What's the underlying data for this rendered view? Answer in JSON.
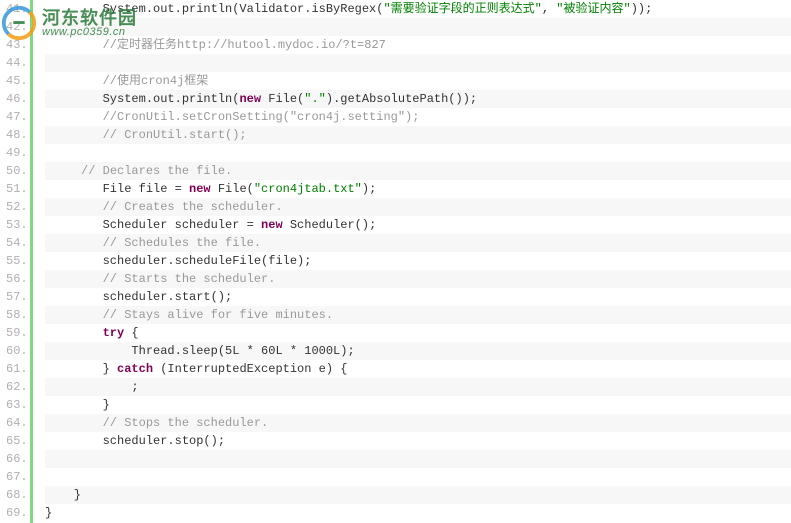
{
  "watermark": {
    "title": "河东软件园",
    "url": "www.pc0359.cn"
  },
  "startLine": 41,
  "lines": [
    {
      "alt": false,
      "tokens": [
        {
          "t": "        System.out.println(Validator.isByRegex(",
          "c": "default"
        },
        {
          "t": "\"需要验证字段的正则表达式\"",
          "c": "string"
        },
        {
          "t": ", ",
          "c": "default"
        },
        {
          "t": "\"被验证内容\"",
          "c": "string"
        },
        {
          "t": "));",
          "c": "default"
        }
      ]
    },
    {
      "alt": true,
      "tokens": [
        {
          "t": "",
          "c": "default"
        }
      ]
    },
    {
      "alt": false,
      "tokens": [
        {
          "t": "        ",
          "c": "default"
        },
        {
          "t": "//定时器任务http://hutool.mydoc.io/?t=827",
          "c": "comment"
        }
      ]
    },
    {
      "alt": true,
      "tokens": [
        {
          "t": "",
          "c": "default"
        }
      ]
    },
    {
      "alt": false,
      "tokens": [
        {
          "t": "        ",
          "c": "default"
        },
        {
          "t": "//使用cron4j框架",
          "c": "comment"
        }
      ]
    },
    {
      "alt": true,
      "tokens": [
        {
          "t": "        System.out.println(",
          "c": "default"
        },
        {
          "t": "new",
          "c": "keyword"
        },
        {
          "t": " File(",
          "c": "default"
        },
        {
          "t": "\".\"",
          "c": "string"
        },
        {
          "t": ").getAbsolutePath());",
          "c": "default"
        }
      ]
    },
    {
      "alt": false,
      "tokens": [
        {
          "t": "        ",
          "c": "default"
        },
        {
          "t": "//CronUtil.setCronSetting(\"cron4j.setting\");",
          "c": "comment"
        }
      ]
    },
    {
      "alt": true,
      "tokens": [
        {
          "t": "        ",
          "c": "default"
        },
        {
          "t": "// CronUtil.start();",
          "c": "comment"
        }
      ]
    },
    {
      "alt": false,
      "tokens": [
        {
          "t": "",
          "c": "default"
        }
      ]
    },
    {
      "alt": true,
      "tokens": [
        {
          "t": "     ",
          "c": "default"
        },
        {
          "t": "// Declares the file.",
          "c": "comment"
        }
      ]
    },
    {
      "alt": false,
      "tokens": [
        {
          "t": "        File file = ",
          "c": "default"
        },
        {
          "t": "new",
          "c": "keyword"
        },
        {
          "t": " File(",
          "c": "default"
        },
        {
          "t": "\"cron4jtab.txt\"",
          "c": "string"
        },
        {
          "t": ");",
          "c": "default"
        }
      ]
    },
    {
      "alt": true,
      "tokens": [
        {
          "t": "        ",
          "c": "default"
        },
        {
          "t": "// Creates the scheduler.",
          "c": "comment"
        }
      ]
    },
    {
      "alt": false,
      "tokens": [
        {
          "t": "        Scheduler scheduler = ",
          "c": "default"
        },
        {
          "t": "new",
          "c": "keyword"
        },
        {
          "t": " Scheduler();",
          "c": "default"
        }
      ]
    },
    {
      "alt": true,
      "tokens": [
        {
          "t": "        ",
          "c": "default"
        },
        {
          "t": "// Schedules the file.",
          "c": "comment"
        }
      ]
    },
    {
      "alt": false,
      "tokens": [
        {
          "t": "        scheduler.scheduleFile(file);",
          "c": "default"
        }
      ]
    },
    {
      "alt": true,
      "tokens": [
        {
          "t": "        ",
          "c": "default"
        },
        {
          "t": "// Starts the scheduler.",
          "c": "comment"
        }
      ]
    },
    {
      "alt": false,
      "tokens": [
        {
          "t": "        scheduler.start();",
          "c": "default"
        }
      ]
    },
    {
      "alt": true,
      "tokens": [
        {
          "t": "        ",
          "c": "default"
        },
        {
          "t": "// Stays alive for five minutes.",
          "c": "comment"
        }
      ]
    },
    {
      "alt": false,
      "tokens": [
        {
          "t": "        ",
          "c": "default"
        },
        {
          "t": "try",
          "c": "keyword"
        },
        {
          "t": " {",
          "c": "default"
        }
      ]
    },
    {
      "alt": true,
      "tokens": [
        {
          "t": "            Thread.sleep(5L * 60L * 1000L);",
          "c": "default"
        }
      ]
    },
    {
      "alt": false,
      "tokens": [
        {
          "t": "        } ",
          "c": "default"
        },
        {
          "t": "catch",
          "c": "keyword"
        },
        {
          "t": " (InterruptedException e) {",
          "c": "default"
        }
      ]
    },
    {
      "alt": true,
      "tokens": [
        {
          "t": "            ;",
          "c": "default"
        }
      ]
    },
    {
      "alt": false,
      "tokens": [
        {
          "t": "        }",
          "c": "default"
        }
      ]
    },
    {
      "alt": true,
      "tokens": [
        {
          "t": "        ",
          "c": "default"
        },
        {
          "t": "// Stops the scheduler.",
          "c": "comment"
        }
      ]
    },
    {
      "alt": false,
      "tokens": [
        {
          "t": "        scheduler.stop();",
          "c": "default"
        }
      ]
    },
    {
      "alt": true,
      "tokens": [
        {
          "t": "",
          "c": "default"
        }
      ]
    },
    {
      "alt": false,
      "tokens": [
        {
          "t": "",
          "c": "default"
        }
      ]
    },
    {
      "alt": true,
      "tokens": [
        {
          "t": "    }",
          "c": "default"
        }
      ]
    },
    {
      "alt": false,
      "tokens": [
        {
          "t": "}",
          "c": "default"
        }
      ]
    }
  ]
}
